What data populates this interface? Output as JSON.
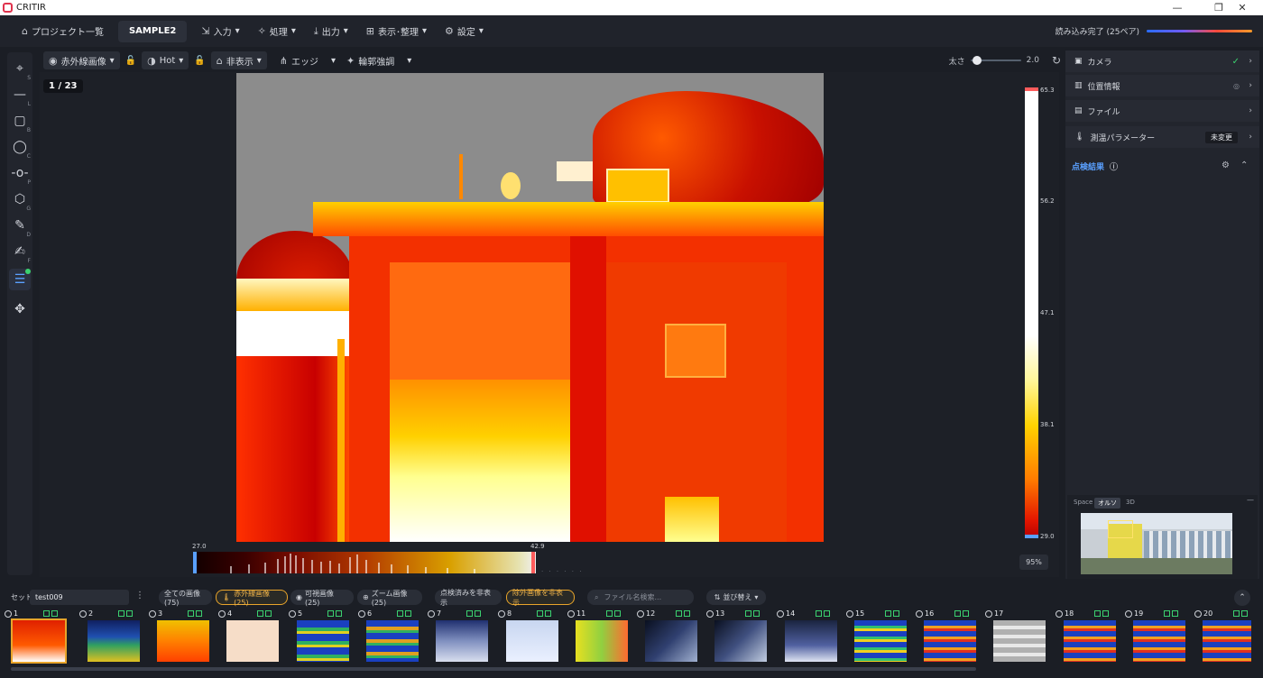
{
  "app": {
    "title": "CRITIR"
  },
  "menubar": {
    "projects_label": "プロジェクト一覧",
    "project_name": "SAMPLE2",
    "input_label": "入力",
    "process_label": "処理",
    "output_label": "出力",
    "view_label": "表示･整理",
    "settings_label": "設定",
    "load_status": "読み込み完了 (25ペア)"
  },
  "viewer_toolbar": {
    "image_type": "赤外線画像",
    "palette": "Hot",
    "visibility": "非表示",
    "edge": "エッジ",
    "contour": "輪郭強調",
    "size_label": "太さ",
    "size_value": "2.0",
    "size_fraction": 0.05
  },
  "viewer": {
    "counter": "1 / 23",
    "zoom": "95%"
  },
  "scale": {
    "max": "65.3",
    "t1": "56.2",
    "t2": "47.1",
    "t3": "38.1",
    "min": "29.0"
  },
  "histogram": {
    "low": "27.0",
    "high": "42.9"
  },
  "right_panel": {
    "camera": "カメラ",
    "location": "位置情報",
    "file": "ファイル",
    "params": "測温パラメーター",
    "params_status": "未変更",
    "inspection": "点検結果"
  },
  "minimap": {
    "tabs": [
      "Space",
      "オルソ",
      "3D"
    ]
  },
  "filters": {
    "set_label": "セット",
    "set_value": "test009",
    "all_images": "全ての画像 (75)",
    "ir_images": "赤外線画像 (25)",
    "visible_images": "可視画像 (25)",
    "zoom_images": "ズーム画像 (25)",
    "hide_inspected": "点検済みを非表示",
    "hide_excluded": "除外画像を非表示",
    "search_placeholder": "ファイル名検索...",
    "sort_label": "並び替え"
  },
  "thumbnails": [
    "1",
    "2",
    "3",
    "4",
    "5",
    "6",
    "7",
    "8",
    "11",
    "12",
    "13",
    "14",
    "15",
    "16",
    "17",
    "18",
    "19",
    "20"
  ],
  "colors": {
    "accent": "#5aa0ff",
    "highlight": "#e8a42a",
    "ok": "#3bd16f"
  }
}
